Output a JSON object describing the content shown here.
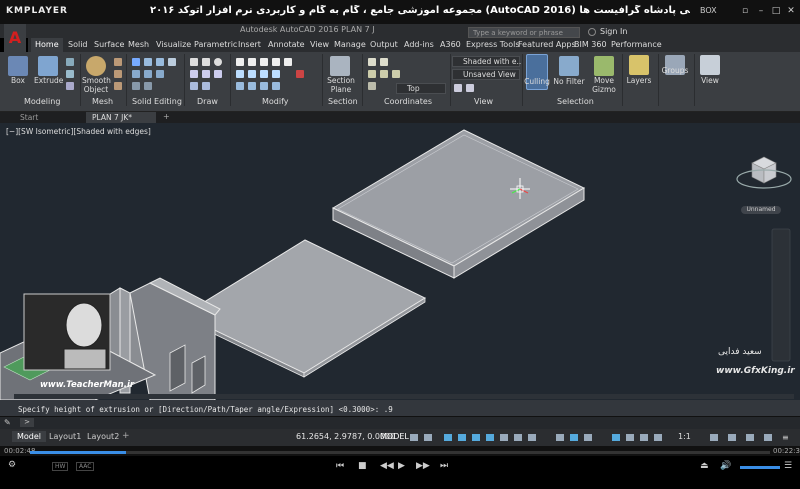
{
  "player": {
    "name": "KMPLAYER",
    "title": "مجموعه آموزشی جامع ، گام به گام و کاربردی نرم افزار اتوکد ۲۰۱۶ (AutoCAD 2016) مدرس : سعید فدایی (تیچرمن) گروه آموزشی پادشاه گرافیست ها",
    "box": "BOX",
    "time_current": "00:02:48",
    "time_total": "00:22:33",
    "progress": 0.13,
    "icons": [
      "prev-icon",
      "stop-icon",
      "play-icon",
      "next-icon",
      "eject-icon",
      "volume-icon",
      "settings-icon"
    ]
  },
  "app": {
    "file": "Autodesk AutoCAD 2016    PLAN 7 J",
    "search_placeholder": "Type a keyword or phrase",
    "signin": "Sign In"
  },
  "ribbon": {
    "tabs": [
      "Home",
      "Solid",
      "Surface",
      "Mesh",
      "Visualize",
      "Parametric",
      "Insert",
      "Annotate",
      "View",
      "Manage",
      "Output",
      "Add-ins",
      "A360",
      "Express Tools",
      "Featured Apps",
      "BIM 360",
      "Performance"
    ],
    "buttons": {
      "box": "Box",
      "extrude": "Extrude",
      "smooth": "Smooth\nObject",
      "section": "Section\nPlane",
      "culling": "Culling",
      "nofilter": "No Filter",
      "move": "Move\nGizmo",
      "layers": "Layers",
      "groups": "Groups",
      "view": "View"
    },
    "panels": [
      "Modeling",
      "Mesh",
      "Solid Editing",
      "Draw",
      "Modify",
      "Section",
      "Coordinates",
      "View",
      "Selection"
    ],
    "dropdowns": {
      "visual_style": "Shaded with e...",
      "saved_view": "Unsaved View",
      "ucs": "Top"
    }
  },
  "file_tabs": {
    "start": "Start",
    "current": "PLAN 7 JK*"
  },
  "viewport": {
    "label": "[−][SW Isometric][Shaded with edges]",
    "viewcube_label": "Unnamed"
  },
  "command": {
    "history": "Specify height of extrusion or [Direction/Path/Taper angle/Expression] <0.3000>: .9",
    "prompt_icon": ">"
  },
  "status": {
    "tabs": [
      "Model",
      "Layout1",
      "Layout2"
    ],
    "coords": "61.2654, 2.9787, 0.0000",
    "mode": "MODEL",
    "scale": "1:1"
  },
  "watermarks": {
    "gfx": "www.GfxKing.ir",
    "teacher": "www.TeacherMan.ir",
    "sign": "سعید فدایی"
  }
}
